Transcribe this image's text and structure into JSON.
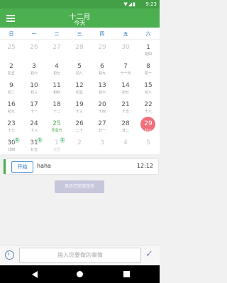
{
  "status": {
    "time": "9:23",
    "icons_text": "▼◢▮"
  },
  "header": {
    "title": "十二月",
    "subtitle": "今天"
  },
  "weekdays": [
    "日",
    "一",
    "二",
    "三",
    "四",
    "五",
    "六"
  ],
  "calendar": [
    [
      {
        "d": "25",
        "s": "",
        "dim": true
      },
      {
        "d": "26",
        "s": "",
        "dim": true
      },
      {
        "d": "27",
        "s": "",
        "dim": true
      },
      {
        "d": "28",
        "s": "",
        "dim": true
      },
      {
        "d": "29",
        "s": "",
        "dim": true
      },
      {
        "d": "30",
        "s": "",
        "dim": true
      },
      {
        "d": "1",
        "s": "初四"
      }
    ],
    [
      {
        "d": "2",
        "s": "初五"
      },
      {
        "d": "3",
        "s": "初六"
      },
      {
        "d": "4",
        "s": "初七"
      },
      {
        "d": "5",
        "s": "初八"
      },
      {
        "d": "6",
        "s": "初九"
      },
      {
        "d": "7",
        "s": "十一月"
      },
      {
        "d": "8",
        "s": "初一"
      }
    ],
    [
      {
        "d": "9",
        "s": "初二"
      },
      {
        "d": "10",
        "s": "初三"
      },
      {
        "d": "11",
        "s": "初四"
      },
      {
        "d": "12",
        "s": "初五"
      },
      {
        "d": "13",
        "s": "初六"
      },
      {
        "d": "14",
        "s": "初七"
      },
      {
        "d": "15",
        "s": "初八"
      }
    ],
    [
      {
        "d": "16",
        "s": "初九"
      },
      {
        "d": "17",
        "s": "十一"
      },
      {
        "d": "18",
        "s": "十二"
      },
      {
        "d": "19",
        "s": "十三"
      },
      {
        "d": "20",
        "s": "十四"
      },
      {
        "d": "21",
        "s": "十五"
      },
      {
        "d": "22",
        "s": "十六"
      }
    ],
    [
      {
        "d": "23",
        "s": "十七"
      },
      {
        "d": "24",
        "s": "十八"
      },
      {
        "d": "25",
        "s": "圣诞节",
        "today": true
      },
      {
        "d": "26",
        "s": "二十"
      },
      {
        "d": "27",
        "s": "廿一"
      },
      {
        "d": "28",
        "s": "廿二"
      },
      {
        "d": "29",
        "s": "廿三",
        "selected": true
      }
    ],
    [
      {
        "d": "30",
        "s": "廿四",
        "badge": "1"
      },
      {
        "d": "31",
        "s": "廿五",
        "badge": "1"
      },
      {
        "d": "1",
        "s": "元旦",
        "dim": true,
        "badge": "1"
      },
      {
        "d": "2",
        "s": "",
        "dim": true
      },
      {
        "d": "3",
        "s": "",
        "dim": true
      },
      {
        "d": "4",
        "s": "",
        "dim": true
      },
      {
        "d": "5",
        "s": "",
        "dim": true
      }
    ]
  ],
  "task": {
    "start_label": "开始",
    "name": "haha",
    "time": "12:12"
  },
  "show_done_label": "显示已完成任务",
  "input": {
    "placeholder": "输入您要做的事情"
  },
  "colors": {
    "primary": "#4caf50",
    "selected": "#f06f7d",
    "weekday": "#2a74c9"
  }
}
